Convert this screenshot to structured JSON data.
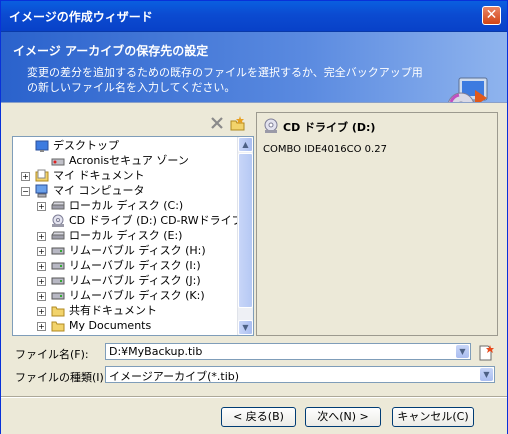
{
  "window": {
    "title": "イメージの作成ウィザード"
  },
  "header": {
    "title": "イメージ アーカイブの保存先の設定",
    "description": "変更の差分を追加するための既存のファイルを選択するか、完全バックアップ用の新しいファイル名を入力してください。"
  },
  "tree": {
    "items": [
      {
        "label": "デスクトップ",
        "icon": "desktop-icon",
        "expander": ""
      },
      {
        "label": "Acronisセキュア ゾーン",
        "icon": "secure-zone-icon",
        "expander": ""
      },
      {
        "label": "マイ ドキュメント",
        "icon": "my-documents-icon",
        "expander": "+"
      },
      {
        "label": "マイ コンピュータ",
        "icon": "my-computer-icon",
        "expander": "−"
      },
      {
        "label": "ローカル ディスク (C:)",
        "icon": "hard-disk-icon",
        "expander": "+"
      },
      {
        "label": "CD ドライブ (D:) CD-RWドライブ",
        "icon": "cd-drive-icon",
        "expander": ""
      },
      {
        "label": "ローカル ディスク (E:)",
        "icon": "hard-disk-icon",
        "expander": "+"
      },
      {
        "label": "リムーバブル ディスク (H:)",
        "icon": "removable-disk-icon",
        "expander": "+"
      },
      {
        "label": "リムーバブル ディスク (I:)",
        "icon": "removable-disk-icon",
        "expander": "+"
      },
      {
        "label": "リムーバブル ディスク (J:)",
        "icon": "removable-disk-icon",
        "expander": "+"
      },
      {
        "label": "リムーバブル ディスク (K:)",
        "icon": "removable-disk-icon",
        "expander": "+"
      },
      {
        "label": "共有ドキュメント",
        "icon": "folder-icon",
        "expander": "+"
      },
      {
        "label": "My Documents",
        "icon": "folder-icon",
        "expander": "+"
      }
    ]
  },
  "info": {
    "title": "CD ドライブ (D:)",
    "description": "COMBO IDE4016CO 0.27"
  },
  "fields": {
    "filename_label": "ファイル名(F):",
    "filename_value": "D:¥MyBackup.tib",
    "filetype_label": "ファイルの種類(I):",
    "filetype_value": "イメージアーカイブ(*.tib)"
  },
  "buttons": {
    "back": "< 戻る(B)",
    "next": "次へ(N) >",
    "cancel": "キャンセル(C)"
  },
  "colors": {
    "title_bar": "#0b4bd1",
    "header": "#2a62cc",
    "dialog_bg": "#ece9d8"
  }
}
